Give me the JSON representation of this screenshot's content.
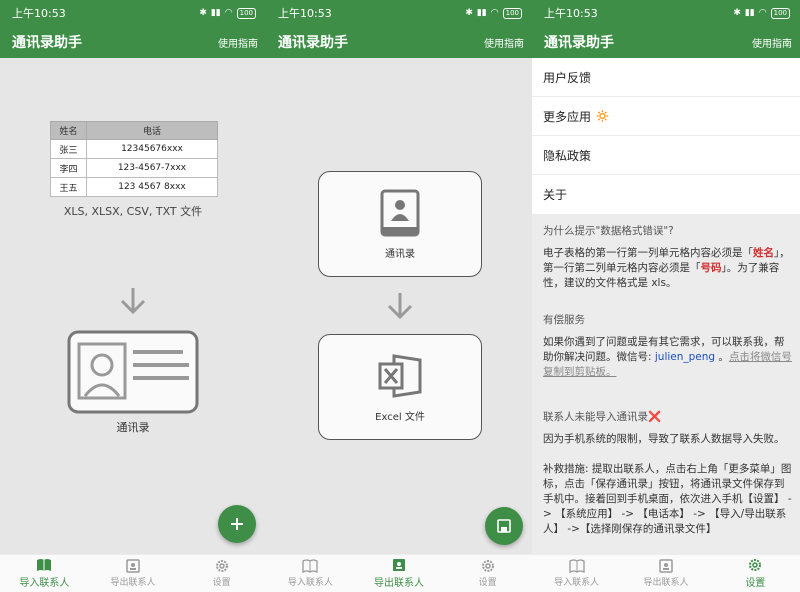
{
  "status_bar": {
    "time": "上午10:53",
    "battery": "100"
  },
  "app_bar": {
    "title": "通讯录助手",
    "guide": "使用指南"
  },
  "bottom_nav": {
    "import": "导入联系人",
    "export": "导出联系人",
    "settings": "设置"
  },
  "import_screen": {
    "table_headers": [
      "姓名",
      "电话"
    ],
    "table_rows": [
      [
        "张三",
        "12345676xxx"
      ],
      [
        "李四",
        "123-4567-7xxx"
      ],
      [
        "王五",
        "123 4567 8xxx"
      ]
    ],
    "formats": "XLS, XLSX, CSV, TXT 文件",
    "contacts_label": "通讯录",
    "fab_icon": "plus-icon"
  },
  "export_screen": {
    "contacts_label": "通讯录",
    "excel_label": "Excel 文件",
    "fab_icon": "save-icon"
  },
  "settings_screen": {
    "menu": [
      "用户反馈",
      "更多应用",
      "隐私政策",
      "关于"
    ],
    "more_apps_emoji": "🔅",
    "faq1_title": "为什么提示\"数据格式错误\"?",
    "faq1_p1a": "电子表格的第一行第一列单元格内容必须是「",
    "faq1_name": "姓名",
    "faq1_p1b": "」，第一行第二列单元格内容必须是「",
    "faq1_phone": "号码",
    "faq1_p1c": "」。为了兼容性，建议的文件格式是 xls。",
    "paid_title": "有偿服务",
    "paid_p1": "如果你遇到了问题或是有其它需求，可以联系我，帮助你解决问题。微信号: ",
    "paid_wechat": "julien_peng",
    "paid_p2": " 。",
    "paid_link": "点击将微信号复制到剪贴板。",
    "faq2_title": "联系人未能导入通讯录",
    "faq2_emoji": "❌",
    "faq2_p1": "因为手机系统的限制，导致了联系人数据导入失败。",
    "faq2_p2": "补救措施: 提取出联系人，点击右上角「更多菜单」图标，点击「保存通讯录」按钮，将通讯录文件保存到手机中。接着回到手机桌面，依次进入手机【设置】 -> 【系统应用】 -> 【电话本】 -> 【导入/导出联系人】 ->【选择刚保存的通讯录文件】"
  },
  "colors": {
    "primary": "#3e8e47",
    "background": "#e6e6e6",
    "red": "#d32f2f",
    "blue": "#1a4fbf"
  }
}
